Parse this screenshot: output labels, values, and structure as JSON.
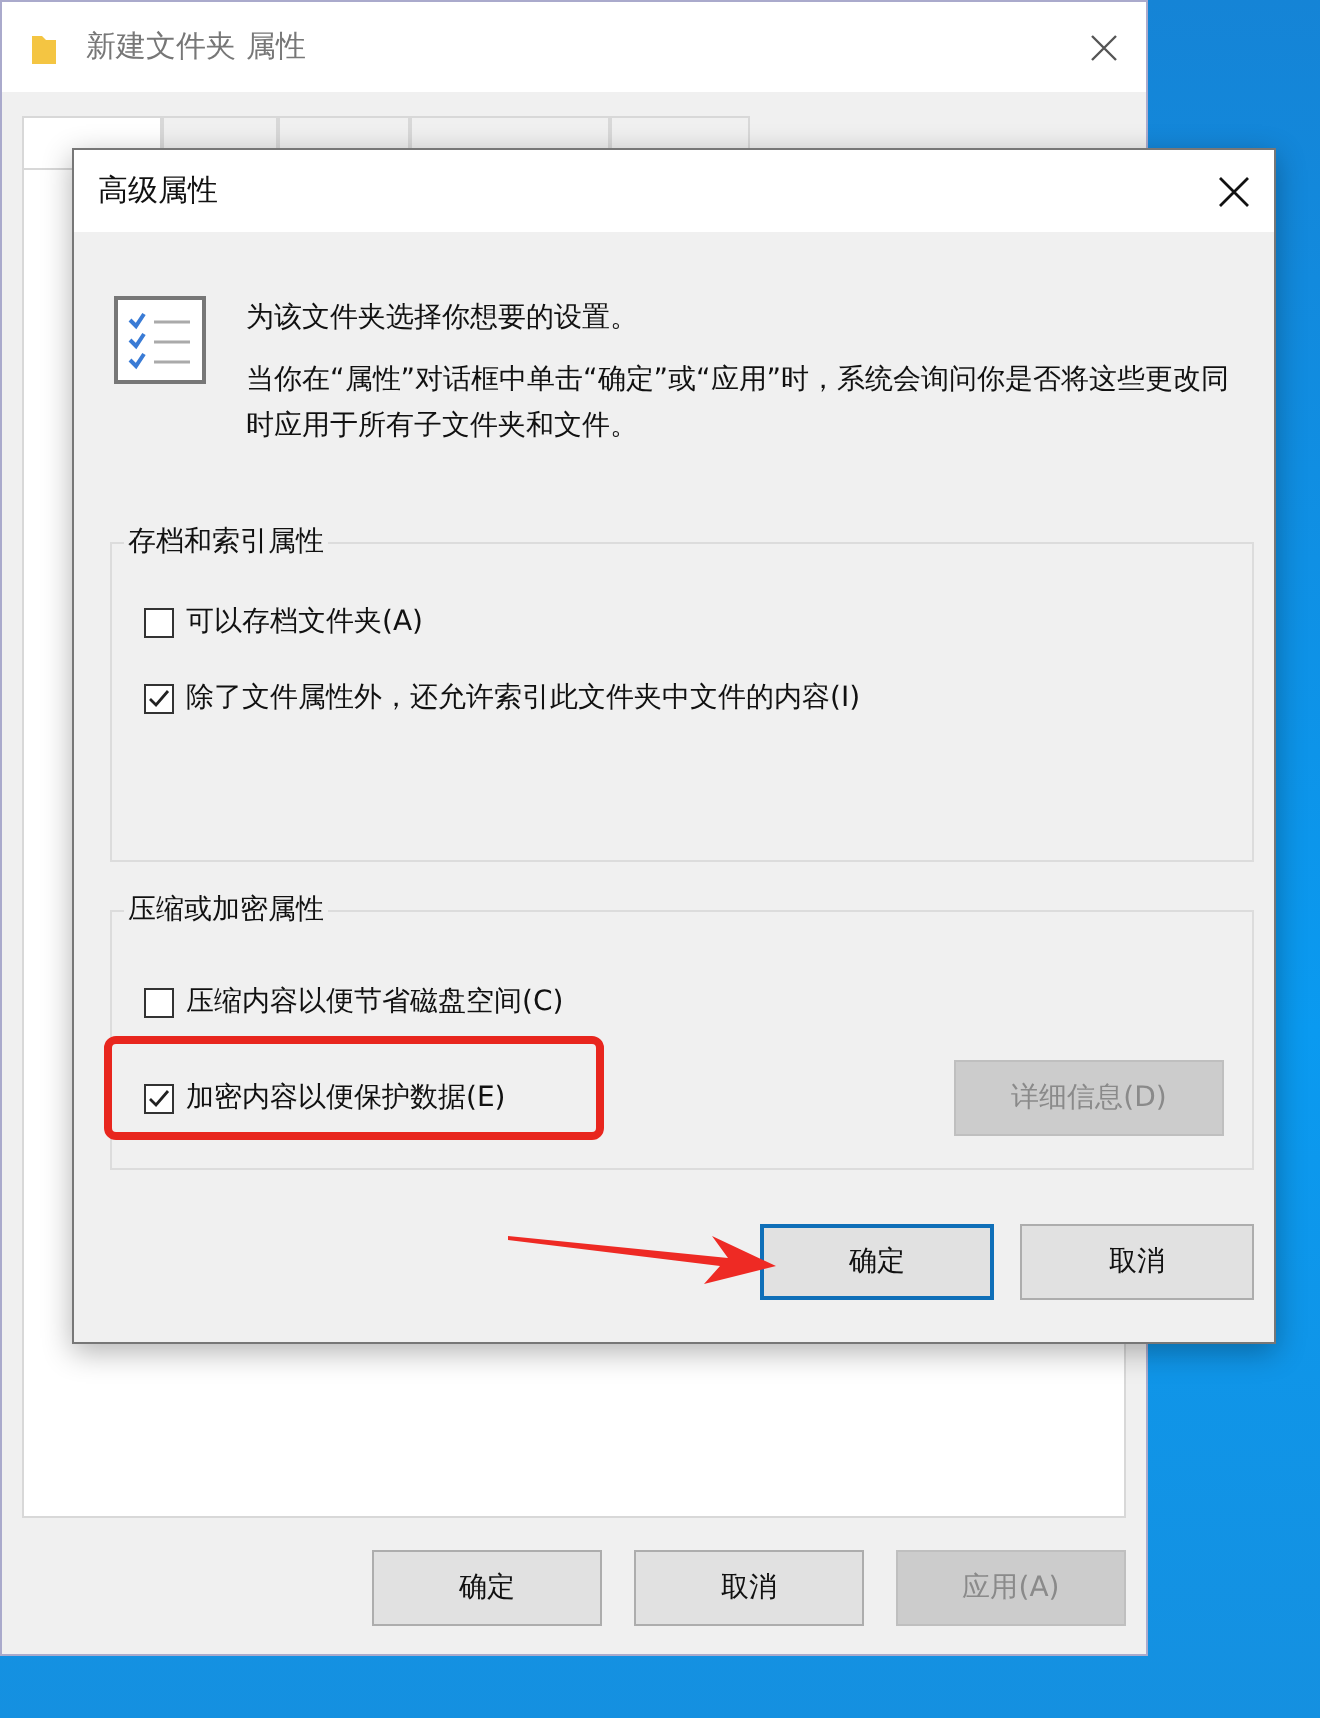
{
  "window": {
    "title": "新建文件夹 属性",
    "tabs": [
      {
        "selected": true
      },
      {
        "selected": false
      },
      {
        "selected": false
      },
      {
        "selected": false
      },
      {
        "selected": false
      }
    ],
    "buttons": [
      {
        "label": "确定",
        "disabled": false
      },
      {
        "label": "取消",
        "disabled": false
      },
      {
        "label": "应用(A)",
        "disabled": true
      }
    ]
  },
  "dialog": {
    "title": "高级属性",
    "intro": [
      "为该文件夹选择你想要的设置。",
      "当你在“属性”对话框中单击“确定”或“应用”时，系统会询问你是否将这些更改同时应用于所有子文件夹和文件。"
    ],
    "groups": [
      {
        "title": "存档和索引属性",
        "options": [
          {
            "label": "可以存档文件夹(A)",
            "checked": false,
            "highlighted": false
          },
          {
            "label": "除了文件属性外，还允许索引此文件夹中文件的内容(I)",
            "checked": true,
            "highlighted": false
          }
        ]
      },
      {
        "title": "压缩或加密属性",
        "options": [
          {
            "label": "压缩内容以便节省磁盘空间(C)",
            "checked": false,
            "highlighted": false
          },
          {
            "label": "加密内容以便保护数据(E)",
            "checked": true,
            "highlighted": true
          }
        ],
        "details_button": {
          "label": "详细信息(D)",
          "disabled": true
        }
      }
    ],
    "buttons": [
      {
        "label": "确定",
        "default": true,
        "pointed_at": true
      },
      {
        "label": "取消",
        "default": false,
        "pointed_at": false
      }
    ]
  }
}
